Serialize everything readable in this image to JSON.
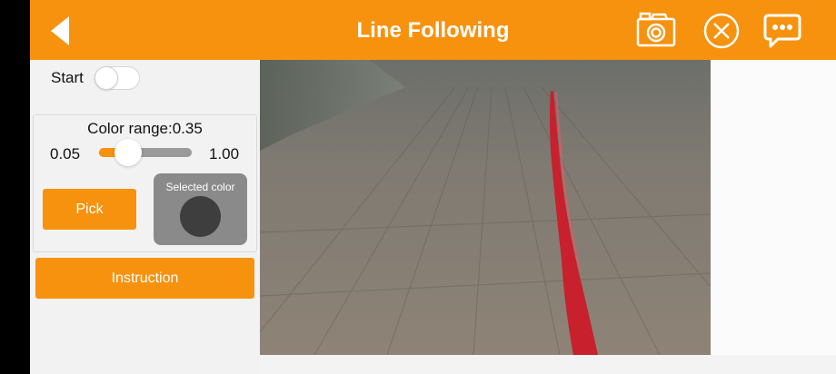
{
  "header": {
    "title": "Line Following",
    "background_color": "#f7920f",
    "icons": {
      "back": "back-arrow-icon",
      "camera": "camera-icon",
      "close": "close-circle-icon",
      "chat": "chat-bubble-icon"
    }
  },
  "controls": {
    "start_label": "Start",
    "start_enabled": false,
    "color_range": {
      "title": "Color range:0.35",
      "min_label": "0.05",
      "max_label": "1.00",
      "value": 0.35,
      "min": 0.05,
      "max": 1.0
    },
    "pick_label": "Pick",
    "selected_color_label": "Selected color",
    "selected_color": "#3e3e3e",
    "instruction_label": "Instruction"
  },
  "colors": {
    "accent": "#f7920f",
    "line": "#c8202c"
  }
}
